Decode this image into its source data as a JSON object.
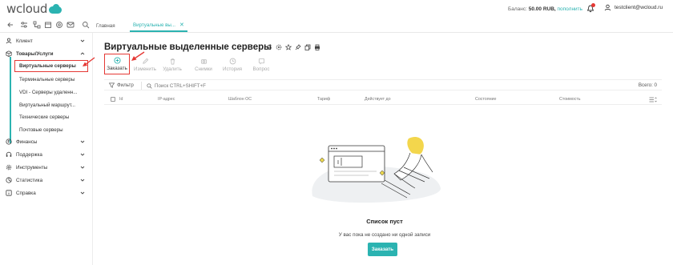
{
  "brand": {
    "logo_text": "wcloud"
  },
  "header": {
    "balance_label": "Баланс:",
    "balance_value": "50.00 RUB,",
    "topup_link": "пополнить",
    "user_email": "testclient@wcloud.ru"
  },
  "tabs": [
    {
      "label": "Главная"
    },
    {
      "label": "Виртуальные вы..."
    }
  ],
  "sidebar": {
    "items": [
      {
        "label": "Клиент",
        "icon": "user-icon"
      },
      {
        "label": "Товары/Услуги",
        "icon": "box-icon"
      },
      {
        "label": "Финансы",
        "icon": "coin-icon"
      },
      {
        "label": "Поддержка",
        "icon": "headset-icon"
      },
      {
        "label": "Инструменты",
        "icon": "gear-icon"
      },
      {
        "label": "Статистика",
        "icon": "chart-icon"
      },
      {
        "label": "Справка",
        "icon": "info-icon"
      }
    ],
    "subitems": [
      {
        "label": "Виртуальные серверы"
      },
      {
        "label": "Терминальные серверы"
      },
      {
        "label": "VDI - Серверы удаленн..."
      },
      {
        "label": "Виртуальный маршрут..."
      },
      {
        "label": "Технические серверы"
      },
      {
        "label": "Почтовые серверы"
      }
    ]
  },
  "main": {
    "title": "Виртуальные выделенные серверы",
    "actions": [
      {
        "label": "Заказать",
        "icon": "plus-circle-icon"
      },
      {
        "label": "Изменить",
        "icon": "pencil-icon"
      },
      {
        "label": "Удалить",
        "icon": "trash-icon"
      },
      {
        "label": "Снимки",
        "icon": "camera-icon"
      },
      {
        "label": "История",
        "icon": "clock-icon"
      },
      {
        "label": "Вопрос",
        "icon": "question-icon"
      }
    ],
    "filter_label": "Фильтр",
    "search_placeholder": "Поиск CTRL+SHIFT+F",
    "total": "Всего: 0",
    "columns": [
      "Id",
      "IP-адрес",
      "Шаблон ОС",
      "Тариф",
      "Действует до",
      "Состояние",
      "Стоимость"
    ],
    "empty_title": "Список пуст",
    "empty_subtitle": "У вас пока не создано ни одной записи",
    "empty_button": "Заказать"
  },
  "colors": {
    "accent": "#2bb3b1",
    "highlight": "#e53935"
  }
}
